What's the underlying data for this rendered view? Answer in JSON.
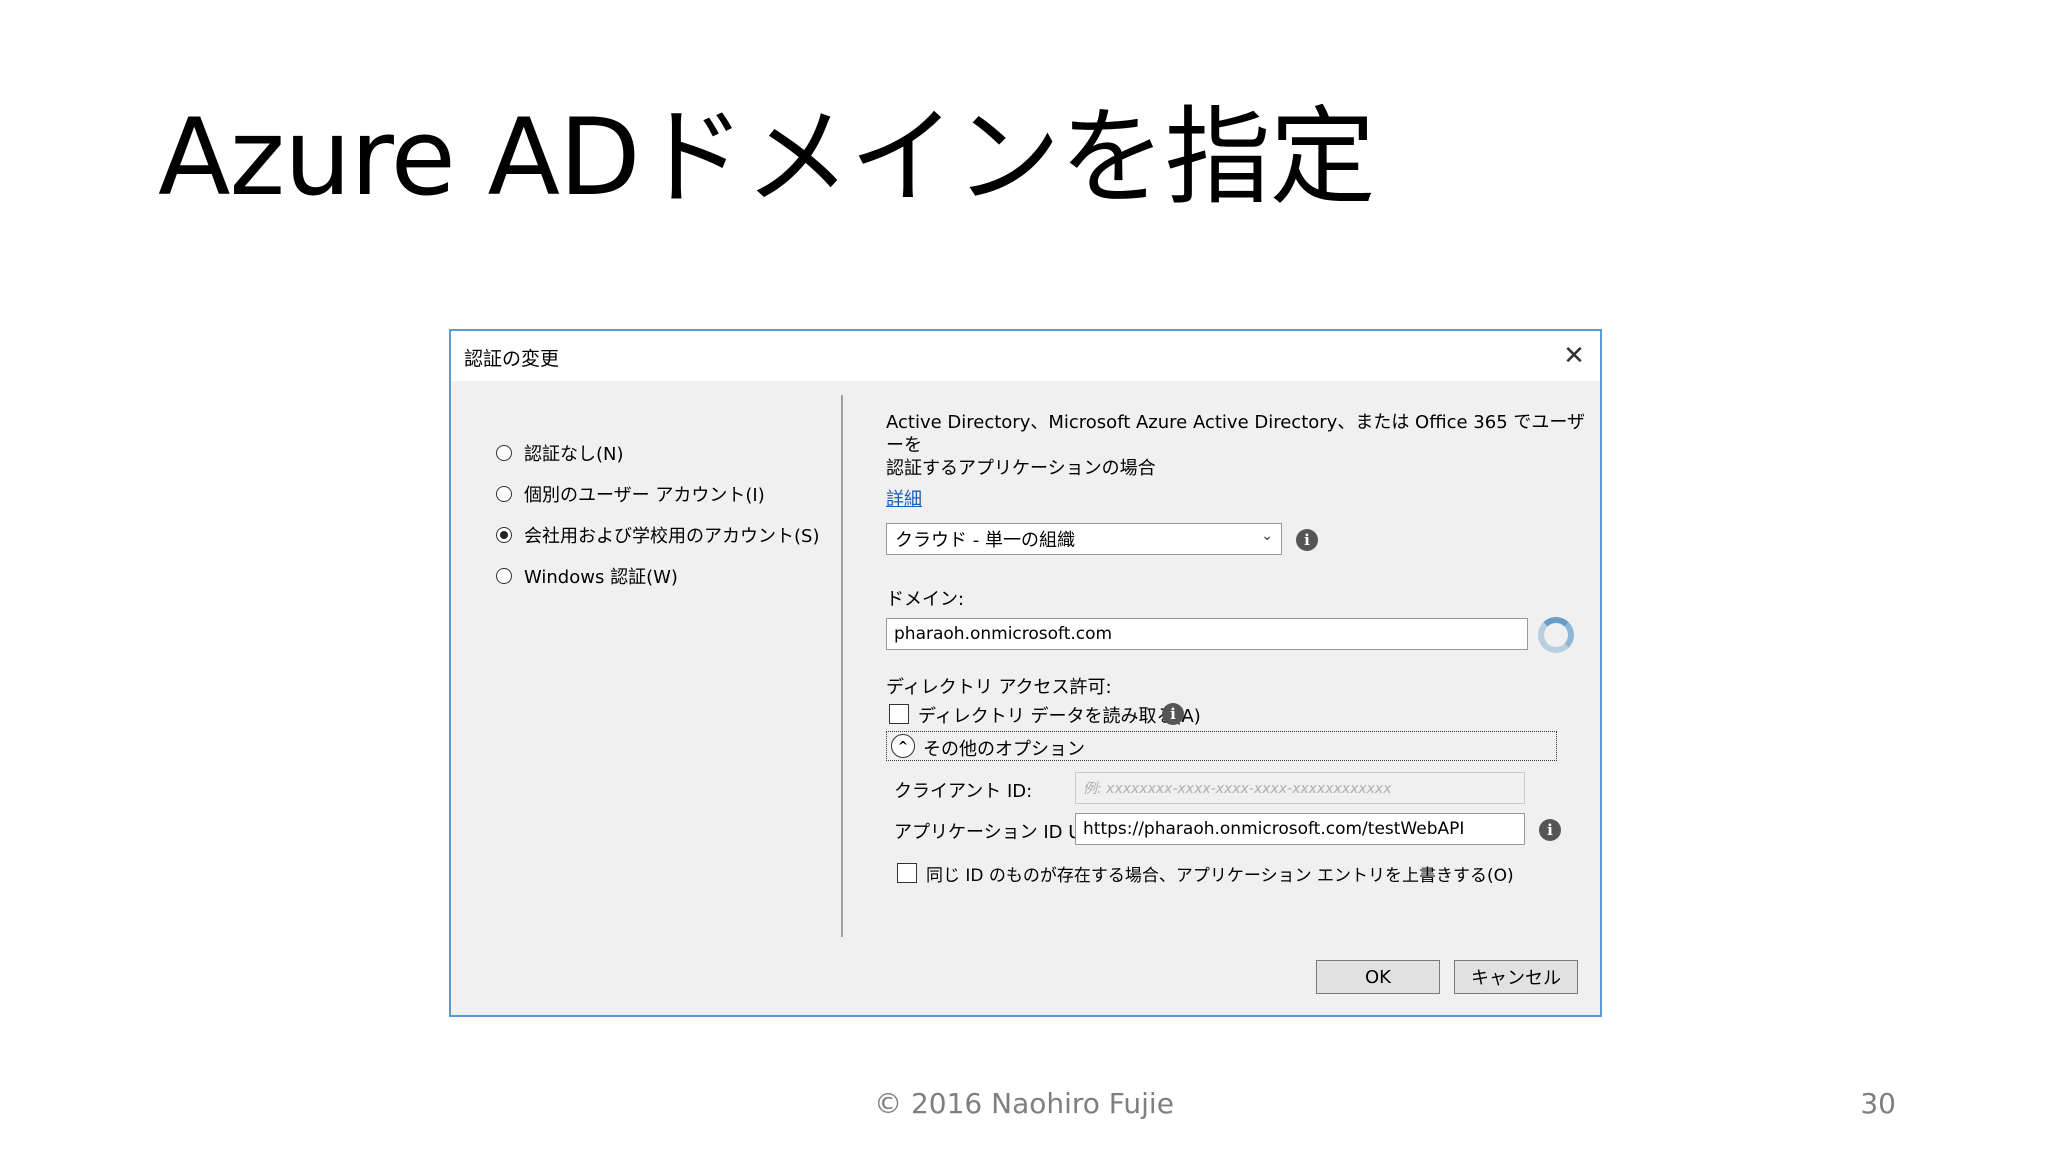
{
  "slide": {
    "title": "Azure ADドメインを指定",
    "footer": "© 2016 Naohiro Fujie",
    "page_number": "30"
  },
  "dialog": {
    "title": "認証の変更",
    "close_icon": "close-icon",
    "auth_options": [
      {
        "label": "認証なし(N)",
        "checked": false
      },
      {
        "label": "個別のユーザー アカウント(I)",
        "checked": false
      },
      {
        "label": "会社用および学校用のアカウント(S)",
        "checked": true
      },
      {
        "label": "Windows 認証(W)",
        "checked": false
      }
    ],
    "description_line1": "Active Directory、Microsoft Azure Active Directory、または Office 365 でユーザーを",
    "description_line2": "認証するアプリケーションの場合",
    "details_link": "詳細",
    "org_type_select": "クラウド - 単一の組織",
    "domain_label": "ドメイン:",
    "domain_value": "pharaoh.onmicrosoft.com",
    "directory_access_label": "ディレクトリ アクセス許可:",
    "read_directory_checkbox": "ディレクトリ データを読み取る(A)",
    "other_options_label": "その他のオプション",
    "client_id_label": "クライアント ID:",
    "client_id_placeholder": "例: xxxxxxxx-xxxx-xxxx-xxxx-xxxxxxxxxxxx",
    "app_id_uri_label": "アプリケーション ID URI:",
    "app_id_uri_value": "https://pharaoh.onmicrosoft.com/testWebAPI",
    "overwrite_checkbox": "同じ ID のものが存在する場合、アプリケーション エントリを上書きする(O)",
    "ok_button": "OK",
    "cancel_button": "キャンセル"
  },
  "icons": {
    "info": "i",
    "chevron_down": "⌄",
    "chevron_up": "^",
    "close": "✕"
  },
  "colors": {
    "dialog_border": "#5b9bd5",
    "link": "#1a5fb4",
    "dialog_bg": "#f0f0f0"
  }
}
